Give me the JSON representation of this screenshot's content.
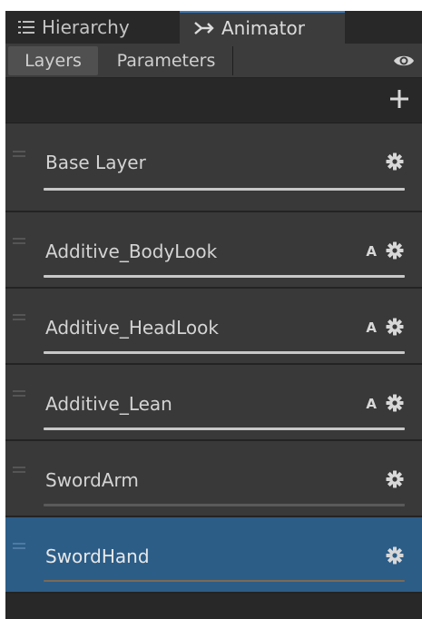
{
  "tabs": [
    {
      "label": "Hierarchy",
      "icon": "list-icon",
      "active": false
    },
    {
      "label": "Animator",
      "icon": "animator-icon",
      "active": true
    }
  ],
  "subtabs": {
    "layers": "Layers",
    "parameters": "Parameters"
  },
  "toolbar": {
    "visibility_icon": "eye-icon",
    "add_icon": "plus-icon"
  },
  "layers": [
    {
      "name": "Base Layer",
      "blend": "",
      "weight": 1.0,
      "selected": false
    },
    {
      "name": "Additive_BodyLook",
      "blend": "A",
      "weight": 1.0,
      "selected": false
    },
    {
      "name": "Additive_HeadLook",
      "blend": "A",
      "weight": 1.0,
      "selected": false
    },
    {
      "name": "Additive_Lean",
      "blend": "A",
      "weight": 1.0,
      "selected": false
    },
    {
      "name": "SwordArm",
      "blend": "",
      "weight": 0.0,
      "selected": false
    },
    {
      "name": "SwordHand",
      "blend": "",
      "weight": 0.0,
      "selected": true
    }
  ],
  "colors": {
    "panel_bg": "#282828",
    "row_bg": "#393939",
    "selected_row": "#2c5d87",
    "active_tab_accent": "#3a79bb"
  }
}
